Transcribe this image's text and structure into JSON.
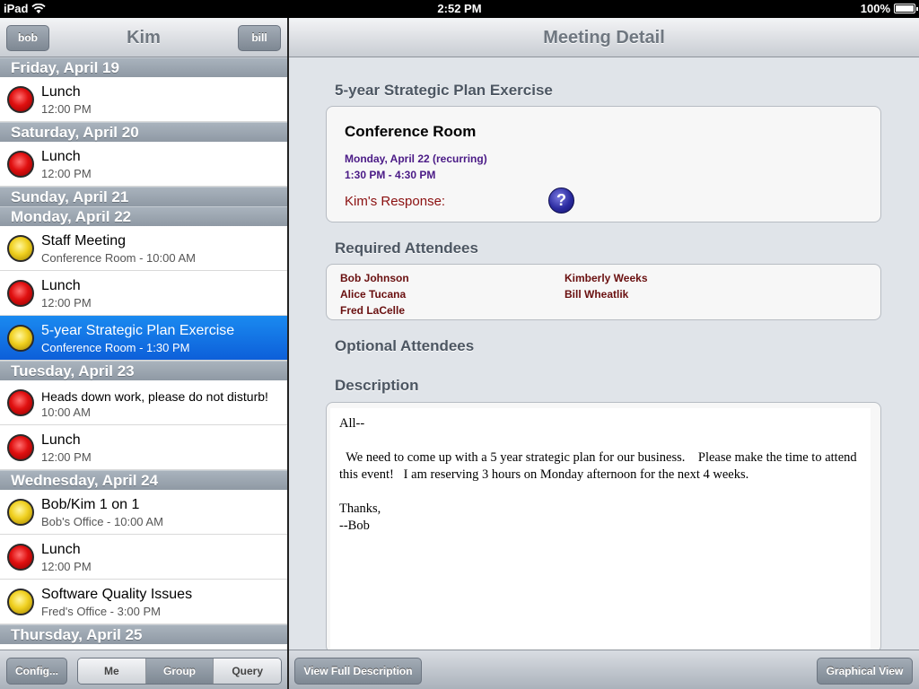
{
  "status": {
    "carrier": "iPad",
    "time": "2:52 PM",
    "battery": "100%"
  },
  "left": {
    "title": "Kim",
    "left_button": "bob",
    "right_button": "bill",
    "days": [
      {
        "header": "Friday, April 19",
        "items": [
          {
            "title": "Lunch",
            "subtitle": "12:00 PM",
            "color": "red"
          }
        ]
      },
      {
        "header": "Saturday, April 20",
        "items": [
          {
            "title": "Lunch",
            "subtitle": "12:00 PM",
            "color": "red"
          }
        ]
      },
      {
        "header": "Sunday, April 21",
        "items": []
      },
      {
        "header": "Monday, April 22",
        "items": [
          {
            "title": "Staff Meeting",
            "subtitle": "Conference Room - 10:00 AM",
            "color": "yellow"
          },
          {
            "title": "Lunch",
            "subtitle": "12:00 PM",
            "color": "red"
          },
          {
            "title": "5-year Strategic Plan Exercise",
            "subtitle": "Conference Room - 1:30 PM",
            "color": "yellow",
            "selected": true
          }
        ]
      },
      {
        "header": "Tuesday, April 23",
        "items": [
          {
            "title": "Heads down work, please do not disturb!",
            "subtitle": "10:00 AM",
            "color": "red"
          },
          {
            "title": "Lunch",
            "subtitle": "12:00 PM",
            "color": "red"
          }
        ]
      },
      {
        "header": "Wednesday, April 24",
        "items": [
          {
            "title": "Bob/Kim 1 on 1",
            "subtitle": "Bob's Office - 10:00 AM",
            "color": "yellow"
          },
          {
            "title": "Lunch",
            "subtitle": "12:00 PM",
            "color": "red"
          },
          {
            "title": "Software Quality Issues",
            "subtitle": "Fred's Office - 3:00 PM",
            "color": "yellow"
          }
        ]
      },
      {
        "header": "Thursday, April 25",
        "items": []
      }
    ],
    "toolbar": {
      "config": "Config...",
      "segments": [
        "Me",
        "Group",
        "Query"
      ],
      "active_segment": "Group"
    }
  },
  "detail": {
    "title": "Meeting Detail",
    "meeting_title": "5-year Strategic Plan Exercise",
    "location": "Conference Room",
    "date": "Monday, April 22 (recurring)",
    "time": "1:30 PM - 4:30 PM",
    "response_label": "Kim's Response:",
    "response_icon": "question-mark-icon",
    "required_label": "Required Attendees",
    "required_col1": [
      "Bob Johnson",
      "Alice Tucana",
      "Fred LaCelle"
    ],
    "required_col2": [
      "Kimberly Weeks",
      "Bill Wheatlik"
    ],
    "optional_label": "Optional Attendees",
    "description_label": "Description",
    "description": "All--\n\n  We need to come up with a 5 year strategic plan for our business.    Please make the time to attend this event!   I am reserving 3 hours on Monday afternoon for the next 4 weeks.\n\nThanks,\n--Bob",
    "toolbar": {
      "view_full": "View Full Description",
      "graphical": "Graphical View"
    }
  },
  "colors": {
    "selected_row": "#0d5fd9",
    "red_dot": "#e01010",
    "yellow_dot": "#f0d020",
    "accent_purple": "#4a1a86"
  }
}
